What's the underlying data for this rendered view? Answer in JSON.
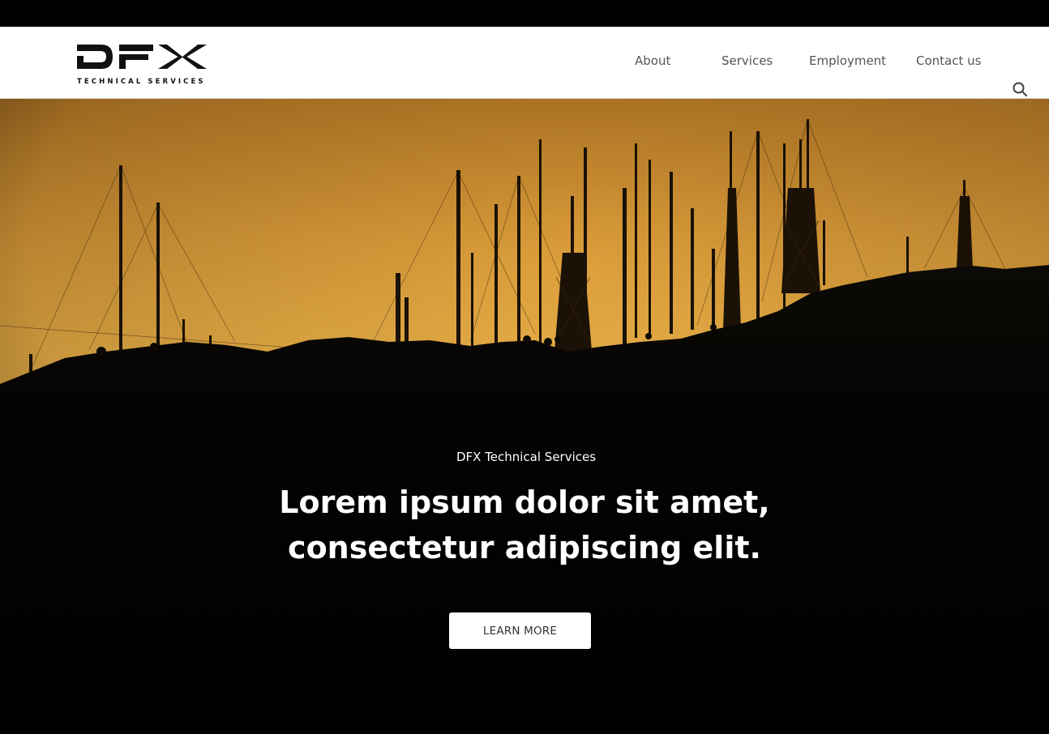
{
  "brand": {
    "logo_text": "DFX",
    "tagline": "TECHNICAL SERVICES"
  },
  "nav": {
    "items": [
      {
        "label": "About"
      },
      {
        "label": "Services"
      },
      {
        "label": "Employment"
      },
      {
        "label": "Contact us"
      }
    ],
    "search_icon": "search-icon"
  },
  "hero": {
    "eyebrow": "DFX Technical Services",
    "headline_line1": "Lorem ipsum dolor sit amet,",
    "headline_line2": "consectetur adipiscing elit.",
    "cta_label": "LEARN MORE",
    "image": "sunset-antenna-towers-on-hill",
    "sky_color_top": "#c2862e",
    "sky_color_horizon": "#f0b84a"
  },
  "colors": {
    "header_bg": "#ffffff",
    "nav_text": "#555555",
    "hero_text": "#ffffff",
    "cta_bg": "#ffffff",
    "cta_text": "#333333"
  }
}
